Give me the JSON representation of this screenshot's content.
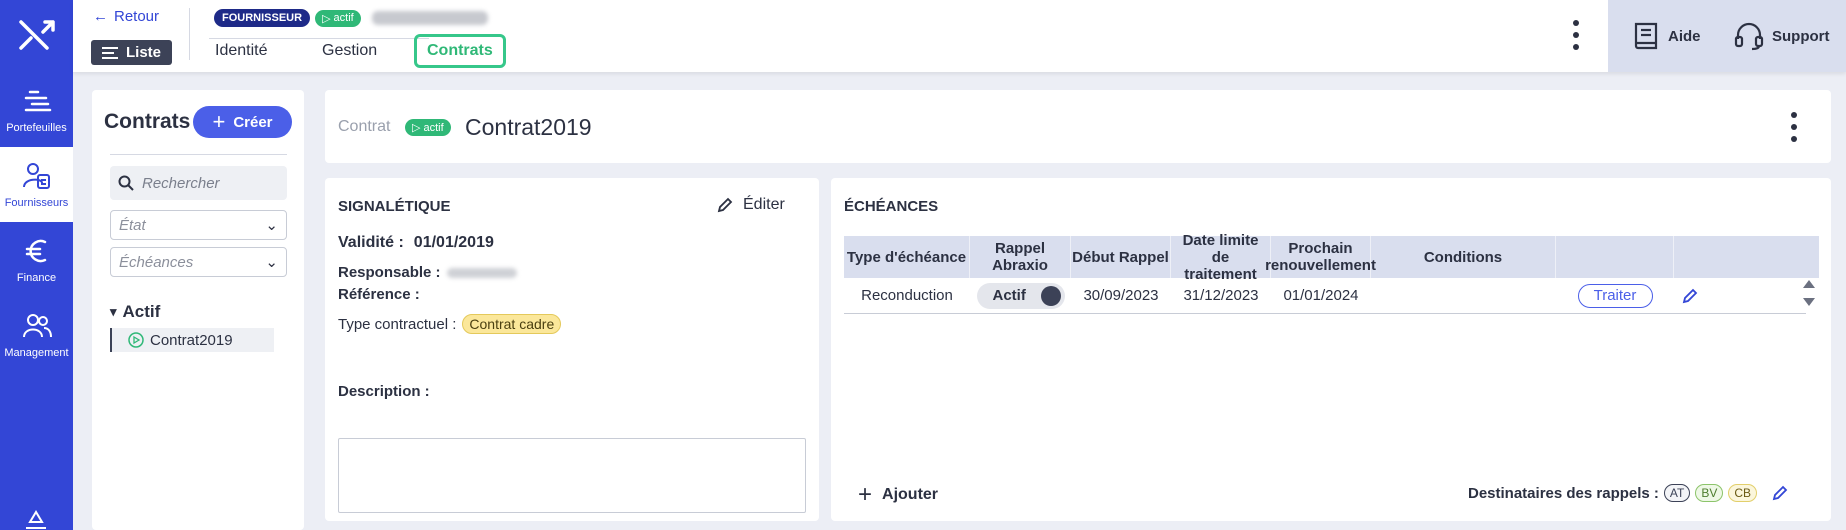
{
  "nav": {
    "items": [
      {
        "label": "Portefeuilles",
        "icon": "portfolio-icon"
      },
      {
        "label": "Fournisseurs",
        "icon": "supplier-icon"
      },
      {
        "label": "Finance",
        "icon": "euro-icon"
      },
      {
        "label": "Management",
        "icon": "users-icon"
      }
    ]
  },
  "topbar": {
    "back_label": "Retour",
    "list_label": "Liste",
    "supplier_badge": "FOURNISSEUR",
    "status_badge": "actif",
    "tabs": [
      {
        "label": "Identité"
      },
      {
        "label": "Gestion"
      },
      {
        "label": "Contrats"
      }
    ],
    "help_label": "Aide",
    "support_label": "Support"
  },
  "sidebar": {
    "title": "Contrats",
    "create_label": "Créer",
    "search_placeholder": "Rechercher",
    "state_placeholder": "État",
    "due_placeholder": "Échéances",
    "group_label": "Actif",
    "contract_item": "Contrat2019"
  },
  "header": {
    "breadcrumb": "Contrat",
    "status_badge": "actif",
    "title": "Contrat2019"
  },
  "signaletique": {
    "title": "SIGNALÉTIQUE",
    "edit_label": "Éditer",
    "validity_label": "Validité :",
    "validity_value": "01/01/2019",
    "responsible_label": "Responsable :",
    "reference_label": "Référence :",
    "contract_type_label": "Type contractuel :",
    "contract_type_value": "Contrat cadre",
    "description_label": "Description :"
  },
  "echeances": {
    "title": "ÉCHÉANCES",
    "columns": [
      "Type d'échéance",
      "Rappel Abraxio",
      "Début Rappel",
      "Date limite de traitement",
      "Prochain renouvellement",
      "Conditions"
    ],
    "rows": [
      {
        "type": "Reconduction",
        "rappel": "Actif",
        "debut": "30/09/2023",
        "limite": "31/12/2023",
        "prochain": "01/01/2024",
        "conditions": "",
        "action": "Traiter"
      }
    ],
    "add_label": "Ajouter",
    "recipients_label": "Destinataires des rappels :",
    "recipients": [
      "AT",
      "BV",
      "CB"
    ]
  },
  "colors": {
    "primary": "#3346d6",
    "accent_green": "#2fb877",
    "button_blue": "#4b5fe8"
  }
}
